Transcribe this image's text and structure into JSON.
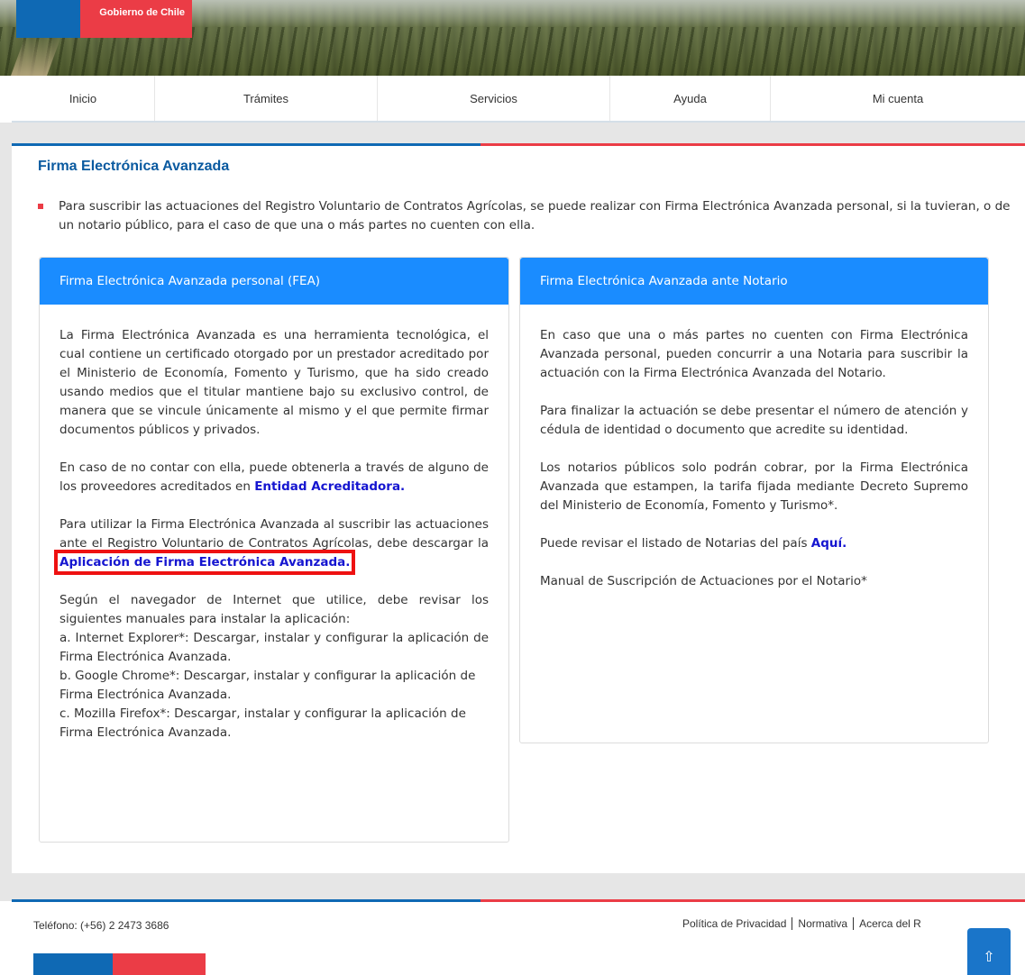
{
  "header": {
    "brand": "Gobierno de Chile"
  },
  "nav": {
    "items": [
      {
        "label": "Inicio"
      },
      {
        "label": "Trámites"
      },
      {
        "label": "Servicios"
      },
      {
        "label": "Ayuda"
      },
      {
        "label": "Mi cuenta"
      }
    ]
  },
  "main": {
    "title": "Firma Electrónica Avanzada",
    "intro": "Para suscribir las actuaciones del Registro Voluntario de Contratos Agrícolas, se puede realizar con Firma Electrónica Avanzada personal, si la tuvieran, o de un notario público, para el caso de que una o más partes no cuenten con ella.",
    "card_personal": {
      "heading": "Firma Electrónica Avanzada personal (FEA)",
      "p1": "La Firma Electrónica Avanzada es una herramienta tecnológica, el cual contiene un certificado otorgado por un prestador acreditado por el Ministerio de Economía, Fomento y Turismo, que ha sido creado usando medios que el titular mantiene bajo su exclusivo control, de manera que se vincule únicamente al mismo y el que permite firmar documentos públicos y privados.",
      "p2_text": "En caso de no contar con ella, puede obtenerla a través de alguno de los proveedores acreditados en ",
      "p2_link": "Entidad Acreditadora.",
      "p3_text": "Para utilizar la Firma Electrónica Avanzada al suscribir las actuaciones ante el Registro Voluntario de Contratos Agrícolas, debe descargar la ",
      "p3_link": "Aplicación de Firma Electrónica Avanzada.",
      "p4_intro": "Según el navegador de Internet que utilice, debe revisar los siguientes manuales para instalar la aplicación:",
      "manual_a": "a. Internet Explorer*: Descargar, instalar y configurar la aplicación de Firma Electrónica Avanzada.",
      "manual_b": "b. Google Chrome*: Descargar, instalar y configurar la aplicación de Firma Electrónica Avanzada.",
      "manual_c": "c. Mozilla Firefox*: Descargar, instalar y configurar la aplicación de Firma Electrónica Avanzada."
    },
    "card_notario": {
      "heading": "Firma Electrónica Avanzada ante Notario",
      "p1": "En caso que una o más partes no cuenten con Firma Electrónica Avanzada personal, pueden concurrir a una Notaria para suscribir la actuación con la Firma Electrónica Avanzada del Notario.",
      "p2": "Para finalizar la actuación se debe presentar el número de atención y cédula de identidad o documento que acredite su identidad.",
      "p3": "Los notarios públicos solo podrán cobrar, por la Firma Electrónica Avanzada que estampen, la tarifa fijada mediante Decreto Supremo del Ministerio de Economía, Fomento y Turismo*.",
      "p4_text": "Puede revisar el listado de Notarias del país ",
      "p4_link": "Aquí.",
      "p5": "Manual de Suscripción de Actuaciones por el Notario*"
    }
  },
  "footer": {
    "phone": "Teléfono: (+56) 2 2473 3686",
    "links": [
      "Política de Privacidad",
      "Normativa",
      "Acerca del R"
    ],
    "totop_icon": "arrow-up-icon"
  },
  "colors": {
    "blue": "#0f69b4",
    "red": "#eb3c46",
    "card_header": "#1a8cff",
    "link": "#1515d0",
    "highlight": "#ee1111"
  }
}
